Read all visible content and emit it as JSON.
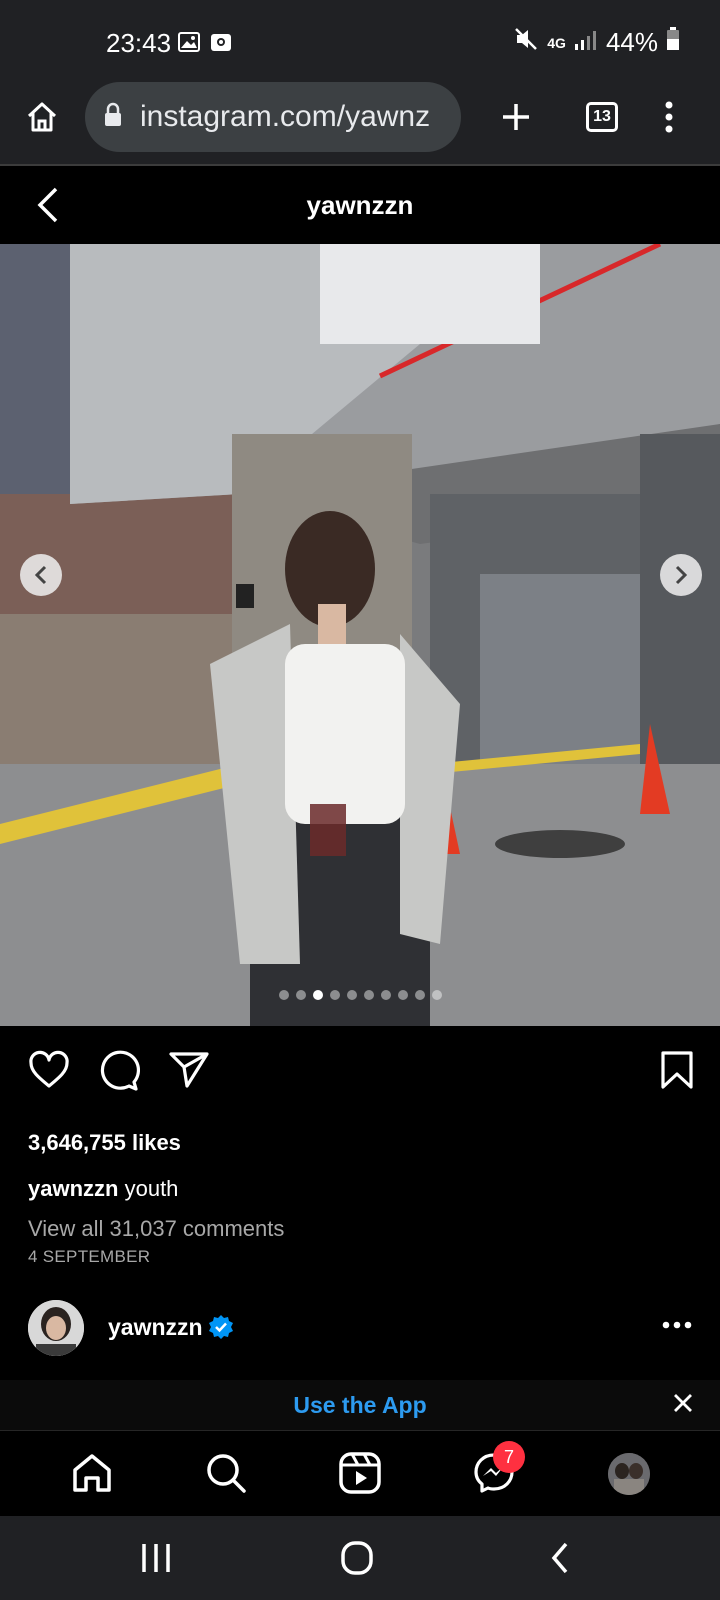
{
  "status_bar": {
    "time": "23:43",
    "network": "4G",
    "battery": "44%",
    "icons": [
      "gallery-icon",
      "camera-notification-icon",
      "mute-icon",
      "signal-icon",
      "battery-icon"
    ]
  },
  "browser": {
    "url": "instagram.com/yawnz",
    "tab_count": "13"
  },
  "header": {
    "title": "yawnzzn"
  },
  "post": {
    "carousel_total": 10,
    "carousel_active": 3,
    "likes": "3,646,755 likes",
    "caption_user": "yawnzzn",
    "caption_text": "youth",
    "view_comments": "View all 31,037 comments",
    "date": "4 SEPTEMBER"
  },
  "author": {
    "name": "yawnzzn",
    "verified": true
  },
  "banner": {
    "label": "Use the App"
  },
  "nav": {
    "messages_badge": "7"
  },
  "colors": {
    "link_blue": "#2d9bf0",
    "badge_red": "#ff3040",
    "verified_blue": "#0095f6"
  }
}
